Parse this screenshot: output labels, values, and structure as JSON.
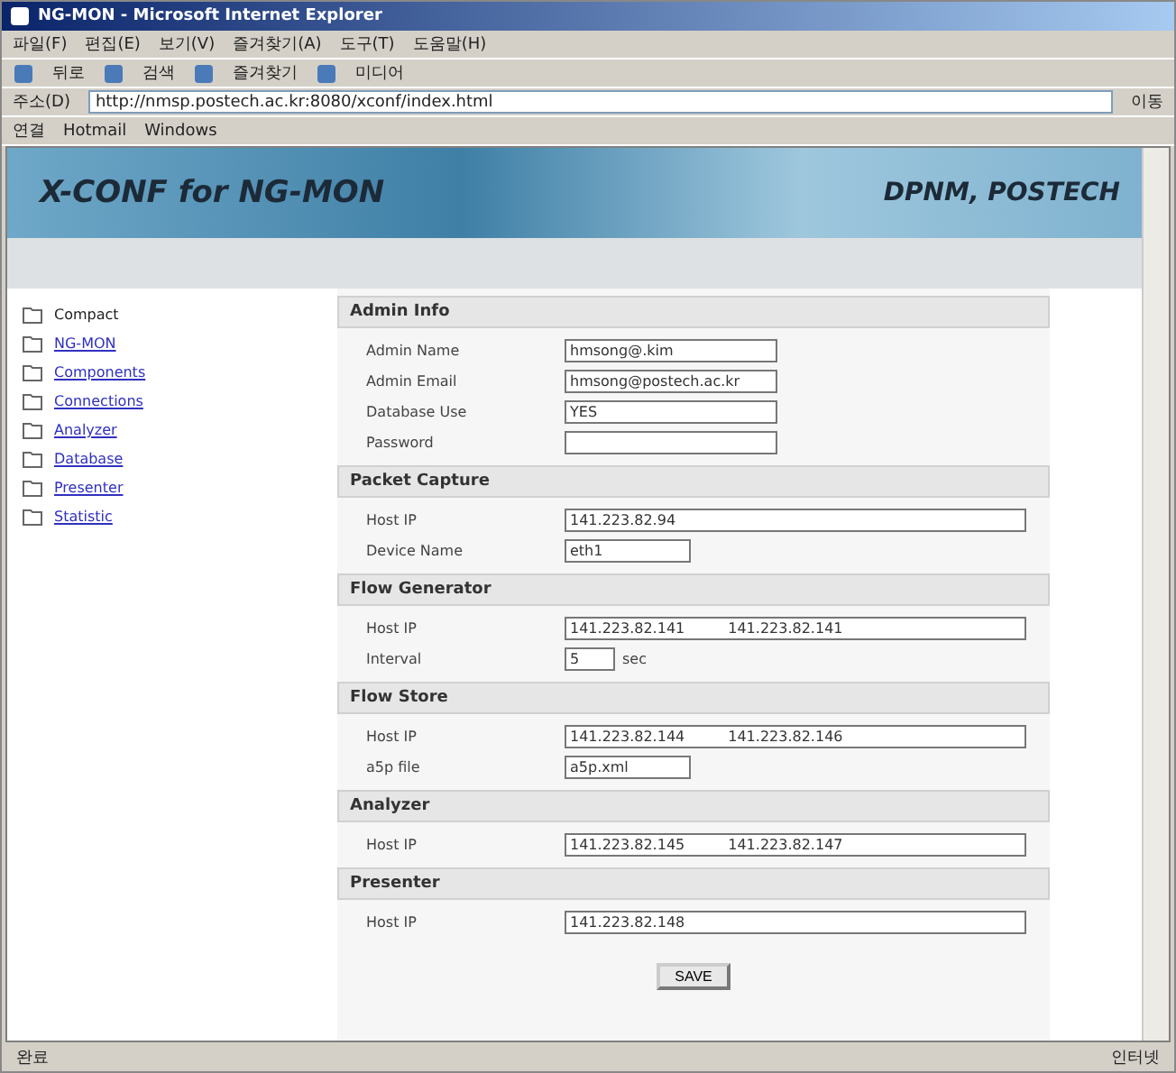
{
  "window": {
    "title": "NG-MON - Microsoft Internet Explorer"
  },
  "menu": [
    "파일(F)",
    "편집(E)",
    "보기(V)",
    "즐겨찾기(A)",
    "도구(T)",
    "도움말(H)"
  ],
  "toolbar": [
    "뒤로",
    "검색",
    "즐겨찾기",
    "미디어"
  ],
  "address": {
    "label": "주소(D)",
    "value": "http://nmsp.postech.ac.kr:8080/xconf/index.html",
    "go": "이동"
  },
  "links_bar": {
    "label": "연결",
    "items": [
      "Hotmail",
      "Windows"
    ]
  },
  "banner": {
    "title": "X-CONF for NG-MON",
    "org": "DPNM, POSTECH"
  },
  "sidebar": {
    "items": [
      {
        "label": "Compact",
        "link": false
      },
      {
        "label": "NG-MON",
        "link": true
      },
      {
        "label": "Components",
        "link": true
      },
      {
        "label": "Connections",
        "link": true
      },
      {
        "label": "Analyzer",
        "link": true
      },
      {
        "label": "Database",
        "link": true
      },
      {
        "label": "Presenter",
        "link": true
      },
      {
        "label": "Statistic",
        "link": true
      }
    ]
  },
  "sections": [
    {
      "title": "Admin Info",
      "fields": [
        {
          "label": "Admin Name",
          "kind": "medium",
          "values": [
            "hmsong@.kim"
          ]
        },
        {
          "label": "Admin Email",
          "kind": "medium",
          "values": [
            "hmsong@postech.ac.kr"
          ]
        },
        {
          "label": "Database Use",
          "kind": "medium",
          "values": [
            "YES"
          ]
        },
        {
          "label": "Password",
          "kind": "medium"
        }
      ]
    },
    {
      "title": "Packet Capture",
      "fields": [
        {
          "label": "Host IP",
          "kind": "wide",
          "values": [
            "141.223.82.94"
          ]
        },
        {
          "label": "Device Name",
          "kind": "short",
          "values": [
            "eth1"
          ]
        }
      ]
    },
    {
      "title": "Flow Generator",
      "fields": [
        {
          "label": "Host IP",
          "kind": "wide",
          "values": [
            "141.223.82.141",
            "141.223.82.141"
          ]
        },
        {
          "label": "Interval",
          "kind": "tiny",
          "values": [
            "5"
          ],
          "suffix": "sec"
        }
      ]
    },
    {
      "title": "Flow Store",
      "fields": [
        {
          "label": "Host IP",
          "kind": "wide",
          "values": [
            "141.223.82.144",
            "141.223.82.146"
          ]
        },
        {
          "label": "a5p file",
          "kind": "short",
          "values": [
            "a5p.xml"
          ]
        }
      ]
    },
    {
      "title": "Analyzer",
      "fields": [
        {
          "label": "Host IP",
          "kind": "wide",
          "values": [
            "141.223.82.145",
            "141.223.82.147"
          ]
        }
      ]
    },
    {
      "title": "Presenter",
      "fields": [
        {
          "label": "Host IP",
          "kind": "wide",
          "values": [
            "141.223.82.148"
          ]
        }
      ]
    }
  ],
  "save_button": "SAVE",
  "status_bar": {
    "text": "완료",
    "zone": "인터넷"
  }
}
